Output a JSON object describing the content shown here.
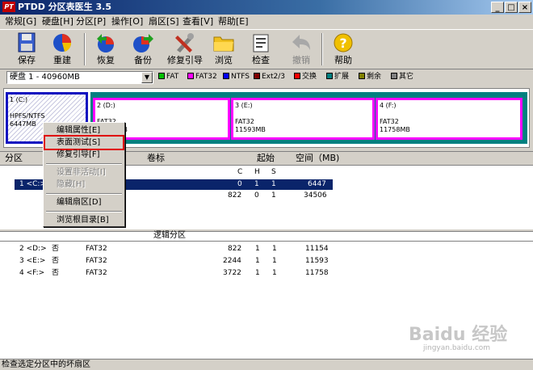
{
  "window": {
    "title": "PTDD 分区表医生 3.5",
    "logo_text": "PT",
    "min_glyph": "_",
    "max_glyph": "□",
    "close_glyph": "×"
  },
  "menubar": [
    "常规[G]",
    "硬盘[H]",
    "分区[P]",
    "操作[O]",
    "扇区[S]",
    "查看[V]",
    "帮助[E]"
  ],
  "toolbar": {
    "save": "保存",
    "rebuild": "重建",
    "restore": "恢复",
    "backup": "备份",
    "repair_boot": "修复引导",
    "browse": "浏览",
    "check": "检查",
    "undo": "撤销",
    "help": "帮助"
  },
  "disk_select": {
    "value": "硬盘 1 - 40960MB",
    "arrow": "▼"
  },
  "legend": [
    {
      "label": "FAT",
      "color": "#00c000"
    },
    {
      "label": "FAT32",
      "color": "#ff00ff"
    },
    {
      "label": "NTFS",
      "color": "#0000ff"
    },
    {
      "label": "Ext2/3",
      "color": "#800000"
    },
    {
      "label": "交换",
      "color": "#ff0000"
    },
    {
      "label": "扩展",
      "color": "#008080"
    },
    {
      "label": "剩余",
      "color": "#808000"
    },
    {
      "label": "其它",
      "color": "#808080"
    }
  ],
  "partitions": [
    {
      "id": "1 (C:)",
      "fs": "HPFS/NTFS",
      "size": "6447MB"
    },
    {
      "id": "2 (D:)",
      "fs": "FAT32",
      "size": "11154MB"
    },
    {
      "id": "3 (E:)",
      "fs": "FAT32",
      "size": "11593MB"
    },
    {
      "id": "4 (F:)",
      "fs": "FAT32",
      "size": "11758MB"
    }
  ],
  "table": {
    "headers": {
      "partition": "分区",
      "label": "卷标",
      "start": "起始",
      "space": "空间（MB)"
    },
    "subheaders": {
      "c": "C",
      "h": "H",
      "s": "S"
    },
    "primary_rows": [
      {
        "part": "1 <C:>",
        "c": "0",
        "h": "1",
        "s": "1",
        "space": "6447"
      },
      {
        "part": "",
        "c": "822",
        "h": "0",
        "s": "1",
        "space": "34506"
      }
    ],
    "logical_header": "逻辑分区",
    "logical_rows": [
      {
        "part": "2 <D:>",
        "active": "否",
        "fs": "FAT32",
        "c": "822",
        "h": "1",
        "s": "1",
        "space": "11154"
      },
      {
        "part": "3 <E:>",
        "active": "否",
        "fs": "FAT32",
        "c": "2244",
        "h": "1",
        "s": "1",
        "space": "11593"
      },
      {
        "part": "4 <F:>",
        "active": "否",
        "fs": "FAT32",
        "c": "3722",
        "h": "1",
        "s": "1",
        "space": "11758"
      }
    ]
  },
  "context_menu": {
    "edit_props": "编辑属性[E]",
    "surface_test": "表面测试[S]",
    "repair_boot": "修复引导[F]",
    "set_inactive": "设置非活动[I]",
    "hide": "隐藏[H]",
    "edit_sector": "编辑扇区[D]",
    "browse_root": "浏览根目录[B]"
  },
  "status": "检查选定分区中的坏扇区",
  "watermark": {
    "brand": "Baidu 经验",
    "url": "jingyan.baidu.com"
  }
}
